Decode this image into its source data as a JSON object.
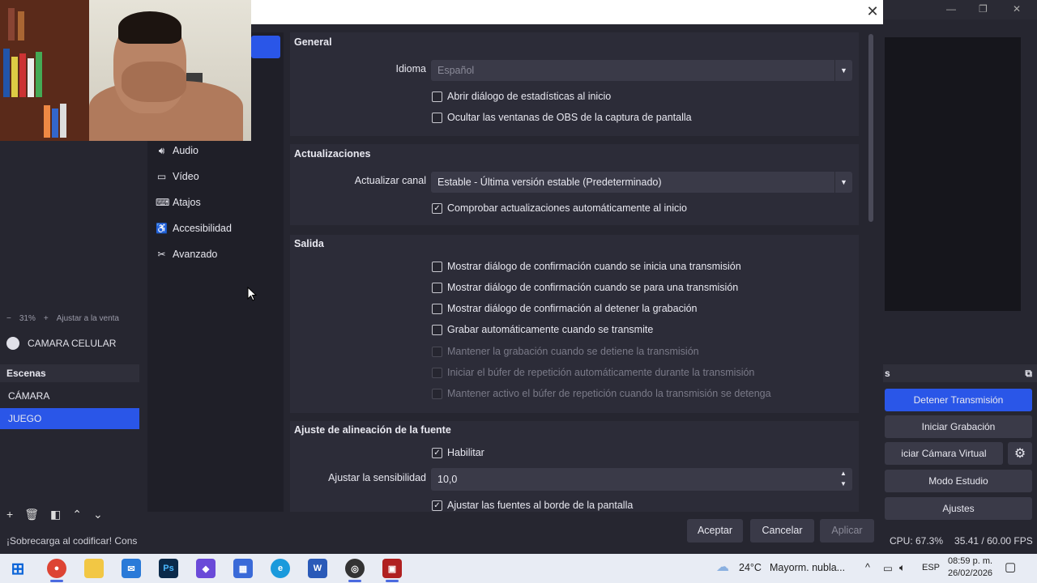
{
  "main": {
    "zoom_minus": "−",
    "zoom_level": "31%",
    "zoom_plus": "+",
    "zoom_fit": "Ajustar a la venta",
    "source_name": "CAMARA CELULAR",
    "scenes_title": "Escenas",
    "scenes": [
      "CÁMARA",
      "JUEGO"
    ],
    "active_scene": "JUEGO",
    "status_message": "¡Sobrecarga al codificar! Cons",
    "controls_title": "s",
    "buttons": {
      "stop_stream": "Detener Transmisión",
      "start_record": "Iniciar Grabación",
      "virtual_cam": "iciar Cámara Virtual",
      "studio_mode": "Modo Estudio",
      "settings": "Ajustes"
    },
    "cpu": "CPU: 67.3%",
    "fps": "35.41 / 60.00 FPS"
  },
  "settings": {
    "nav": [
      {
        "label": "Audio",
        "icon": "speaker-icon"
      },
      {
        "label": "Vídeo",
        "icon": "monitor-icon"
      },
      {
        "label": "Atajos",
        "icon": "keyboard-icon"
      },
      {
        "label": "Accesibilidad",
        "icon": "accessibility-icon"
      },
      {
        "label": "Avanzado",
        "icon": "tools-icon"
      }
    ],
    "general": {
      "title": "General",
      "language_label": "Idioma",
      "language_value": "Español",
      "open_stats": "Abrir diálogo de estadísticas al inicio",
      "hide_windows": "Ocultar las ventanas de OBS de la captura de pantalla"
    },
    "updates": {
      "title": "Actualizaciones",
      "channel_label": "Actualizar canal",
      "channel_value": "Estable - Última versión estable (Predeterminado)",
      "check_updates": "Comprobar actualizaciones automáticamente al inicio"
    },
    "output": {
      "title": "Salida",
      "items": [
        {
          "label": "Mostrar diálogo de confirmación cuando se inicia una transmisión",
          "checked": false,
          "disabled": false
        },
        {
          "label": "Mostrar diálogo de confirmación cuando se para una transmisión",
          "checked": false,
          "disabled": false
        },
        {
          "label": "Mostrar diálogo de confirmación al detener la grabación",
          "checked": false,
          "disabled": false
        },
        {
          "label": "Grabar automáticamente cuando se transmite",
          "checked": false,
          "disabled": false
        },
        {
          "label": "Mantener la grabación cuando se detiene la transmisión",
          "checked": false,
          "disabled": true
        },
        {
          "label": "Iniciar el búfer de repetición automáticamente durante la transmisión",
          "checked": false,
          "disabled": true
        },
        {
          "label": "Mantener activo el búfer de repetición cuando la transmisión se detenga",
          "checked": false,
          "disabled": true
        }
      ]
    },
    "snapping": {
      "title": "Ajuste de alineación de la fuente",
      "enable": "Habilitar",
      "sensitivity_label": "Ajustar la sensibilidad",
      "sensitivity_value": "10,0",
      "snap_edges": "Ajustar las fuentes al borde de la pantalla"
    },
    "buttons": {
      "ok": "Aceptar",
      "cancel": "Cancelar",
      "apply": "Aplicar"
    }
  },
  "taskbar": {
    "weather_temp": "24°C",
    "weather_desc": "Mayorm. nubla...",
    "language": "ESP",
    "time": "08:59 p. m.",
    "date": "26/02/2026"
  }
}
